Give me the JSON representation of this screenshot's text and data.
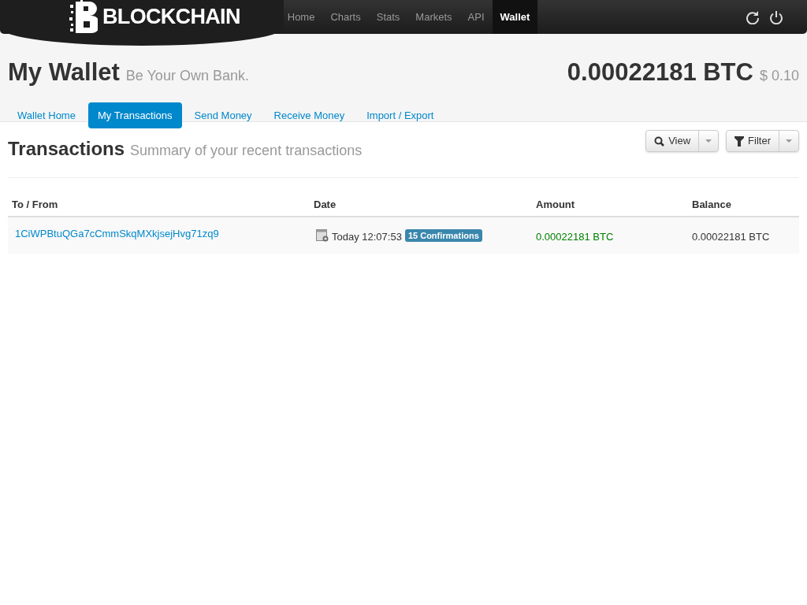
{
  "navbar": {
    "logo": "BLOCKCHAIN",
    "links": [
      {
        "label": "Home",
        "selected": false
      },
      {
        "label": "Charts",
        "selected": false
      },
      {
        "label": "Stats",
        "selected": false
      },
      {
        "label": "Markets",
        "selected": false
      },
      {
        "label": "API",
        "selected": false
      },
      {
        "label": "Wallet",
        "selected": true
      }
    ]
  },
  "header": {
    "title": "My Wallet",
    "subtitle": "Be Your Own Bank.",
    "balance": "0.00022181 BTC",
    "fiat": "$ 0.10"
  },
  "tabs": [
    {
      "label": "Wallet Home",
      "selected": false
    },
    {
      "label": "My Transactions",
      "selected": true
    },
    {
      "label": "Send Money",
      "selected": false
    },
    {
      "label": "Receive Money",
      "selected": false
    },
    {
      "label": "Import / Export",
      "selected": false
    }
  ],
  "section": {
    "title": "Transactions",
    "subtitle": "Summary of your recent transactions",
    "buttons": [
      {
        "kind": "view",
        "label": "View"
      },
      {
        "kind": "filter",
        "label": "Filter"
      }
    ]
  },
  "table": {
    "columns": [
      "To / From",
      "Date",
      "Amount",
      "Balance"
    ],
    "rows": [
      {
        "address": "1CiWPBtuQGa7cCmmSkqMXkjsejHvg71zq9",
        "date": "Today 12:07:53",
        "confirmations": "15 Confirmations",
        "amount": "0.00022181 BTC",
        "incoming": true,
        "balance": "0.00022181 BTC"
      }
    ]
  }
}
